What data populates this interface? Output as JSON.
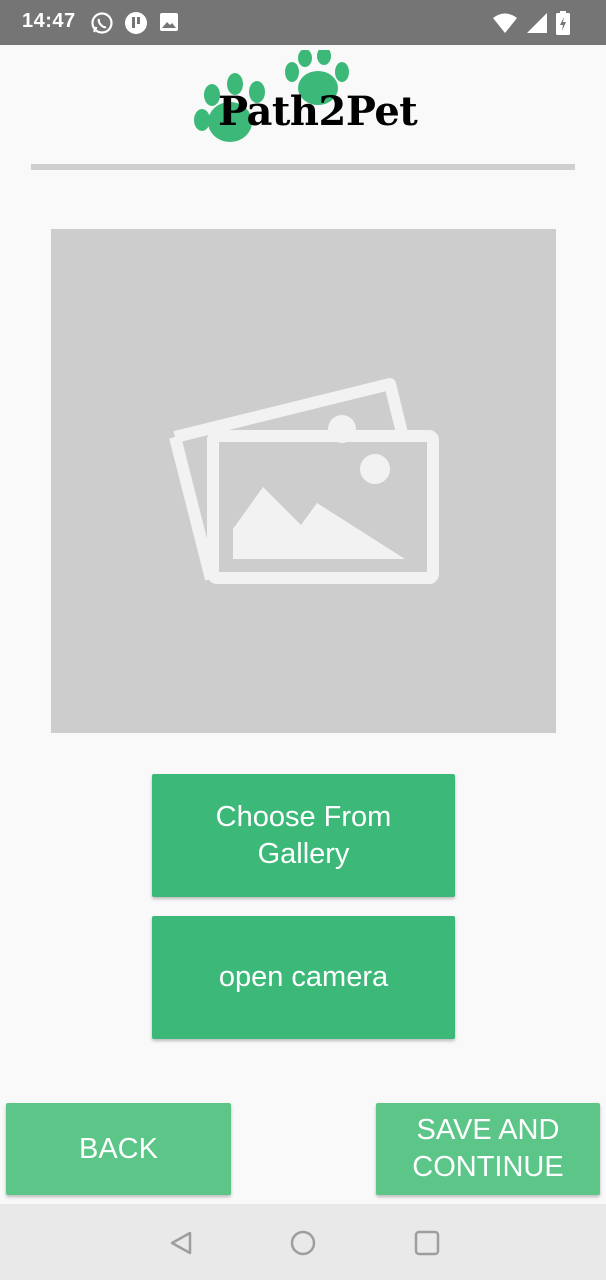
{
  "status_bar": {
    "time": "14:47",
    "left_icons": [
      "whatsapp-icon",
      "app-notification-icon",
      "image-notification-icon"
    ],
    "right_icons": [
      "wifi-icon",
      "signal-icon",
      "battery-charging-icon"
    ],
    "background": "#757575"
  },
  "header": {
    "logo_text": "Path2Pet",
    "logo_color": "#3cb979"
  },
  "photo_placeholder": {
    "icon": "image-placeholder-icon",
    "background": "#cdcdcd"
  },
  "buttons": {
    "gallery_line1": "Choose From",
    "gallery_line2": "Gallery",
    "camera": "open camera",
    "back": "BACK",
    "save_line1": "SAVE AND",
    "save_line2": "CONTINUE",
    "primary_color": "#3cb979",
    "secondary_color": "#5cc689"
  },
  "nav_bar": {
    "icons": [
      "back-nav-icon",
      "home-nav-icon",
      "recents-nav-icon"
    ]
  }
}
